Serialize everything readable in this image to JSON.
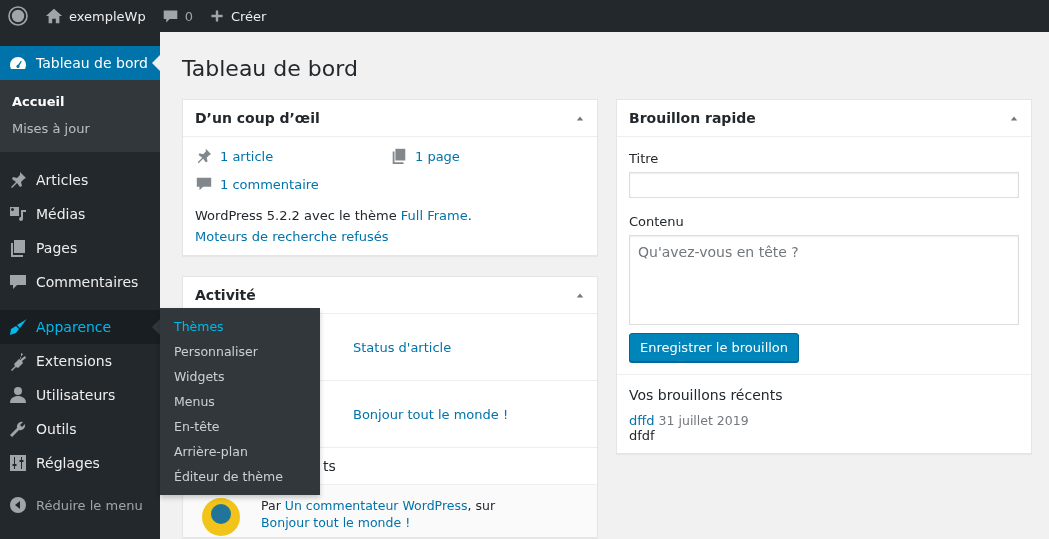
{
  "admin_bar": {
    "site_name": "exempleWp",
    "comment_count": "0",
    "new_label": "Créer"
  },
  "sidebar": {
    "groups": [
      [
        {
          "label": "Tableau de bord",
          "selected": true,
          "expanded": false,
          "children": [
            {
              "label": "Accueil",
              "selected": true
            },
            {
              "label": "Mises à jour",
              "selected": false
            }
          ]
        }
      ],
      [
        {
          "label": "Articles",
          "selected": false,
          "expanded": false
        },
        {
          "label": "Médias",
          "selected": false,
          "expanded": false
        },
        {
          "label": "Pages",
          "selected": false,
          "expanded": false
        },
        {
          "label": "Commentaires",
          "selected": false,
          "expanded": false
        }
      ],
      [
        {
          "label": "Apparence",
          "selected": false,
          "expanded": true,
          "flyout": [
            {
              "label": "Thèmes",
              "selected": true
            },
            {
              "label": "Personnaliser",
              "selected": false
            },
            {
              "label": "Widgets",
              "selected": false
            },
            {
              "label": "Menus",
              "selected": false
            },
            {
              "label": "En-tête",
              "selected": false
            },
            {
              "label": "Arrière-plan",
              "selected": false
            },
            {
              "label": "Éditeur de thème",
              "selected": false
            }
          ]
        },
        {
          "label": "Extensions",
          "selected": false,
          "expanded": false
        },
        {
          "label": "Utilisateurs",
          "selected": false,
          "expanded": false
        },
        {
          "label": "Outils",
          "selected": false,
          "expanded": false
        },
        {
          "label": "Réglages",
          "selected": false,
          "expanded": false
        }
      ]
    ],
    "collapse_label": "Réduire le menu"
  },
  "page_title": "Tableau de bord",
  "glance": {
    "title": "D’un coup d’œil",
    "counts": [
      {
        "label": "1 article"
      },
      {
        "label": "1 page"
      },
      {
        "label": "1 commentaire"
      }
    ],
    "version_before": "WordPress 5.2.2 avec le thème ",
    "theme_link": "Full Frame",
    "version_after": ".",
    "search_engines": "Moteurs de recherche refusés"
  },
  "activity": {
    "title": "Activité",
    "rows": [
      {
        "kind": "post",
        "title": "Status d'article"
      },
      {
        "kind": "post",
        "title": "Bonjour tout le monde !"
      },
      {
        "kind": "heading",
        "text": "ts"
      },
      {
        "kind": "comment",
        "prefix": "Par ",
        "author": "Un commentateur WordPress",
        "middle": ", sur ",
        "post": "Bonjour tout le monde !"
      }
    ]
  },
  "quick_draft": {
    "title": "Brouillon rapide",
    "title_label": "Titre",
    "content_label": "Contenu",
    "content_placeholder": "Qu'avez-vous en tête ?",
    "button": "Enregistrer le brouillon",
    "recent_heading": "Vos brouillons récents",
    "drafts": [
      {
        "title": "dffd",
        "date": "31 juillet 2019",
        "excerpt": "dfdf"
      }
    ]
  }
}
